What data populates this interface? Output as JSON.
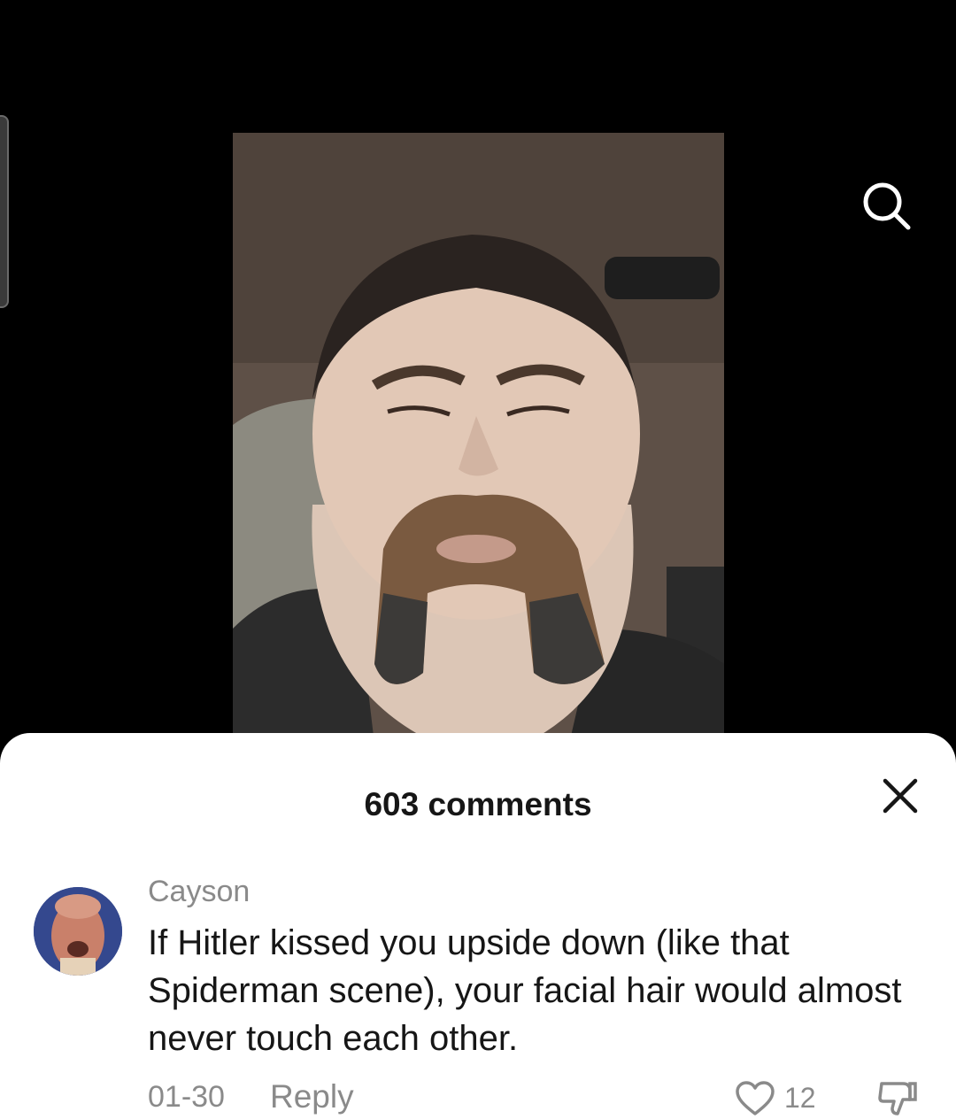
{
  "comments_panel": {
    "title": "603 comments",
    "comment": {
      "username": "Cayson",
      "text": "If Hitler kissed you upside down (like that Spiderman scene), your facial hair would almost never touch each other.",
      "date": "01-30",
      "reply_label": "Reply",
      "like_count": "12"
    }
  },
  "icons": {
    "search": "search-icon",
    "close": "close-icon",
    "like": "heart-icon",
    "dislike": "thumbs-down-icon"
  },
  "colors": {
    "background": "#000000",
    "sheet": "#ffffff",
    "muted_text": "#8a8a8a",
    "primary_text": "#161616"
  }
}
